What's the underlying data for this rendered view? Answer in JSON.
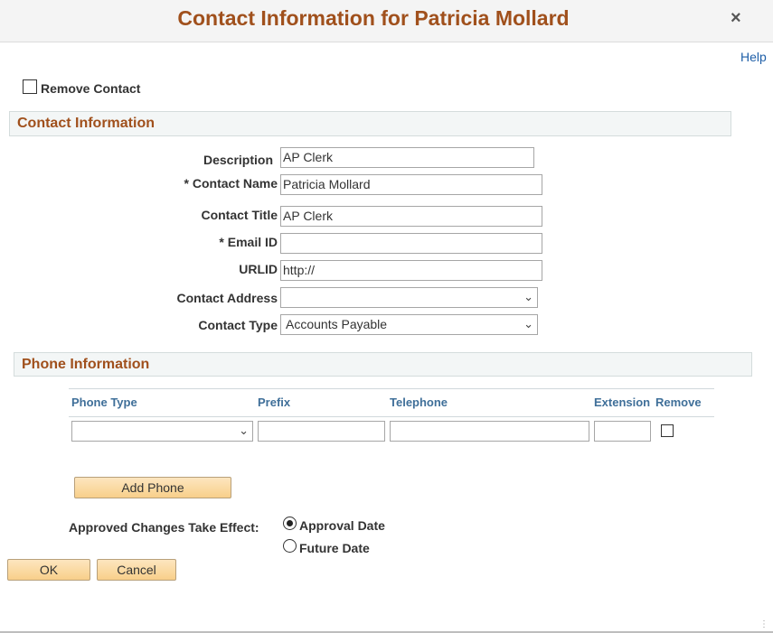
{
  "dialog": {
    "title": "Contact Information for Patricia Mollard",
    "close_icon": "×",
    "help_label": "Help"
  },
  "remove_contact": {
    "label": "Remove Contact",
    "checked": false
  },
  "contact_section": {
    "title": "Contact Information",
    "description_label": "Description",
    "description_value": "AP Clerk",
    "contact_name_label": "* Contact Name",
    "contact_name_value": "Patricia Mollard",
    "contact_title_label": "Contact Title",
    "contact_title_value": "AP Clerk",
    "email_label": "* Email ID",
    "email_value": "",
    "urlid_label": "URLID",
    "urlid_value": "http://",
    "address_label": "Contact Address",
    "address_value": "",
    "type_label": "Contact Type",
    "type_value": "Accounts Payable"
  },
  "phone_section": {
    "title": "Phone Information",
    "columns": {
      "phone_type": "Phone Type",
      "prefix": "Prefix",
      "telephone": "Telephone",
      "extension": "Extension",
      "remove": "Remove"
    },
    "row": {
      "phone_type": "",
      "prefix": "",
      "telephone": "",
      "extension": "",
      "remove": false
    },
    "add_phone_label": "Add Phone"
  },
  "effective": {
    "label": "Approved Changes Take Effect:",
    "options": [
      "Approval Date",
      "Future Date"
    ],
    "selected": "Approval Date"
  },
  "buttons": {
    "ok": "OK",
    "cancel": "Cancel"
  },
  "icons": {
    "chevron": "chevron-down-icon",
    "close": "close-icon"
  }
}
